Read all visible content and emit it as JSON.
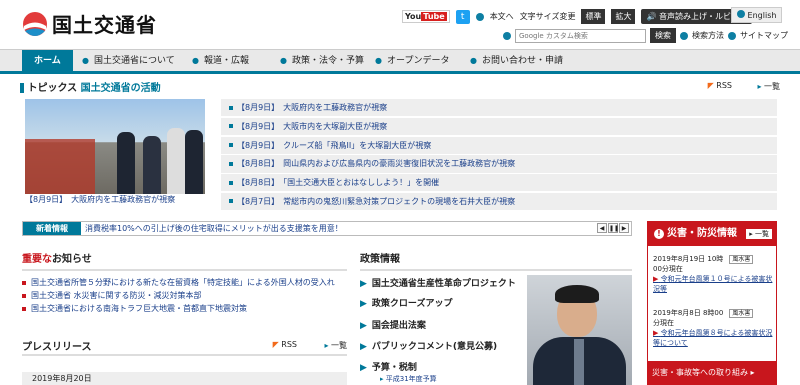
{
  "header": {
    "site_title": "国土交通省",
    "youtube_label_you": "You",
    "youtube_label_tube": "Tube",
    "twitter_icon_text": "t",
    "honbun_label": "本文へ",
    "text_size_label": "文字サイズ変更",
    "text_size_standard": "標準",
    "text_size_large": "拡大",
    "voice_label": "音声読み上げ・ルビ振り",
    "english_label": "English",
    "search_placeholder": "Google カスタム検索",
    "search_button": "検索",
    "search_method": "検索方法",
    "sitemap": "サイトマップ"
  },
  "nav": {
    "items": [
      "ホーム",
      "国土交通省について",
      "報道・広報",
      "政策・法令・予算",
      "オープンデータ",
      "お問い合わせ・申請"
    ]
  },
  "topics": {
    "prefix": "トピックス",
    "title": "国土交通省の活動",
    "rss": "RSS",
    "all": "一覧",
    "photo_caption": "【8月9日】　大阪府内を工藤政務官が視察",
    "items": [
      "【8月9日】　大阪府内を工藤政務官が視察",
      "【8月9日】　大阪市内を大塚副大臣が視察",
      "【8月9日】　クルーズ船「飛鳥II」を大塚副大臣が視察",
      "【8月8日】　岡山県内および広島県内の豪雨災害復旧状況を工藤政務官が視察",
      "【8月8日】　「国土交通大臣とおはなししよう！」を開催",
      "【8月7日】　常総市内の鬼怒川緊急対策プロジェクトの現場を石井大臣が視察"
    ]
  },
  "newinfo": {
    "label": "新着情報",
    "text": "消費税率10%への引上げ後の住宅取得にメリットが出る支援策を用意！",
    "prev": "◀",
    "pause": "❚❚",
    "next": "▶"
  },
  "important": {
    "title_red": "重要な",
    "title_rest": "お知らせ",
    "items": [
      "国土交通省所管５分野における新たな在留資格「特定技能」による外国人材の受入れ",
      "国土交通省 水災害に関する防災・減災対策本部",
      "国土交通省における南海トラフ巨大地震・首都直下地震対策"
    ]
  },
  "press": {
    "title": "プレスリリース",
    "rss": "RSS",
    "all": "一覧",
    "date": "2019年8月20日"
  },
  "policy": {
    "title": "政策情報",
    "items": [
      "国土交通省生産性革命プロジェクト",
      "政策クローズアップ",
      "国会提出法案",
      "パブリックコメント(意見公募)",
      "予算・税制"
    ],
    "sub_item": "平成31年度予算"
  },
  "disaster": {
    "title": "災害・防災情報",
    "all": "一覧",
    "entries": [
      {
        "date": "2019年8月19日 10時",
        "tag": "風水害",
        "note": "00分現在",
        "link": "令和元年台風第１０号による被害状況等"
      },
      {
        "date": "2019年8月8日 8時00",
        "tag": "風水害",
        "note": "分現在",
        "link": "令和元年台風第８号による被害状況等について"
      }
    ],
    "footer": "災害・事故等への取り組み"
  },
  "colors": {
    "accent": "#00799a",
    "alert": "#c8161d"
  }
}
